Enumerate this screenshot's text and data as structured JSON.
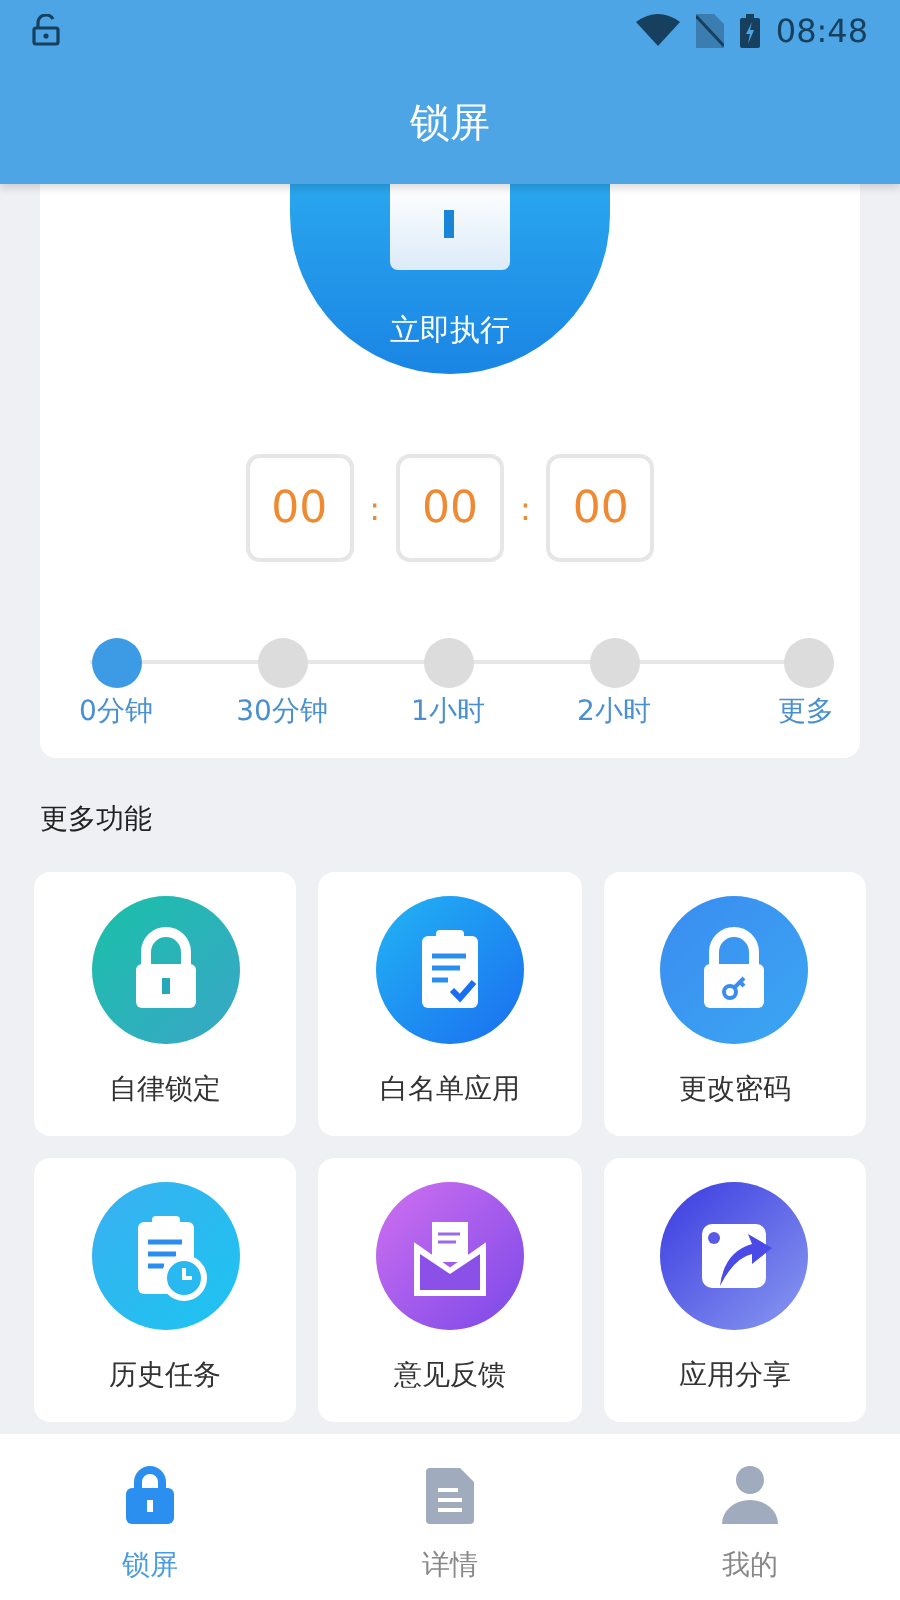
{
  "status_bar": {
    "time": "08:48"
  },
  "header": {
    "title": "锁屏"
  },
  "lock_button": {
    "label": "立即执行"
  },
  "timer": [
    "00",
    "00",
    "00"
  ],
  "timer_separator": ":",
  "durations": [
    {
      "label": "0分钟",
      "selected": true
    },
    {
      "label": "30分钟",
      "selected": false
    },
    {
      "label": "1小时",
      "selected": false
    },
    {
      "label": "2小时",
      "selected": false
    },
    {
      "label": "更多",
      "selected": false
    }
  ],
  "more_section": {
    "title": "更多功能"
  },
  "features": [
    {
      "kind": "lock",
      "label": "自律锁定"
    },
    {
      "kind": "clipboard",
      "label": "白名单应用"
    },
    {
      "kind": "keylock",
      "label": "更改密码"
    },
    {
      "kind": "history",
      "label": "历史任务"
    },
    {
      "kind": "mail",
      "label": "意见反馈"
    },
    {
      "kind": "share",
      "label": "应用分享"
    }
  ],
  "tabs": [
    {
      "kind": "lock",
      "label": "锁屏",
      "selected": true
    },
    {
      "kind": "doc",
      "label": "详情",
      "selected": false
    },
    {
      "kind": "person",
      "label": "我的",
      "selected": false
    }
  ]
}
